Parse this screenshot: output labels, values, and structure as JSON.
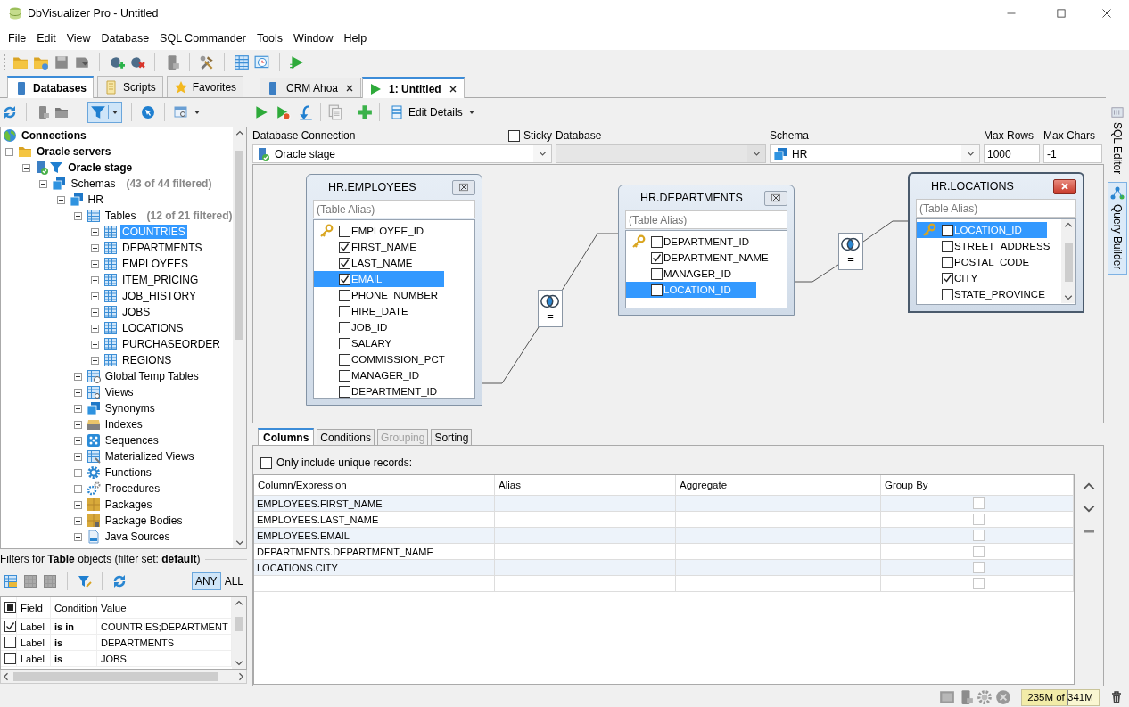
{
  "window": {
    "title": "DbVisualizer Pro - Untitled"
  },
  "menu": [
    "File",
    "Edit",
    "View",
    "Database",
    "SQL Commander",
    "Tools",
    "Window",
    "Help"
  ],
  "left_tabs": [
    {
      "label": "Databases",
      "kind": "databases",
      "selected": true
    },
    {
      "label": "Scripts",
      "kind": "scripts",
      "selected": false
    },
    {
      "label": "Favorites",
      "kind": "favorites",
      "selected": false
    }
  ],
  "tree": {
    "label": "Connections",
    "kind": "root",
    "selected": false,
    "children": [
      {
        "label": "Oracle servers",
        "kind": "folder",
        "expanded": true,
        "selected": false,
        "children": [
          {
            "label": "Oracle stage",
            "kind": "connection",
            "expanded": true,
            "selected": false,
            "children": [
              {
                "label": "Schemas",
                "note": "(43 of 44 filtered)",
                "kind": "schemas",
                "expanded": true,
                "selected": false,
                "children": [
                  {
                    "label": "HR",
                    "kind": "schema",
                    "expanded": true,
                    "selected": false,
                    "children": [
                      {
                        "label": "Tables",
                        "note": "(12 of 21 filtered)",
                        "kind": "tables",
                        "expanded": true,
                        "selected": false,
                        "children": [
                          {
                            "label": "COUNTRIES",
                            "kind": "table",
                            "expanded": false,
                            "selected": true
                          },
                          {
                            "label": "DEPARTMENTS",
                            "kind": "table",
                            "expanded": false,
                            "selected": false
                          },
                          {
                            "label": "EMPLOYEES",
                            "kind": "table",
                            "expanded": false,
                            "selected": false
                          },
                          {
                            "label": "ITEM_PRICING",
                            "kind": "table",
                            "expanded": false,
                            "selected": false
                          },
                          {
                            "label": "JOB_HISTORY",
                            "kind": "table",
                            "expanded": false,
                            "selected": false
                          },
                          {
                            "label": "JOBS",
                            "kind": "table",
                            "expanded": false,
                            "selected": false
                          },
                          {
                            "label": "LOCATIONS",
                            "kind": "table",
                            "expanded": false,
                            "selected": false
                          },
                          {
                            "label": "PURCHASEORDER",
                            "kind": "table",
                            "expanded": false,
                            "selected": false
                          },
                          {
                            "label": "REGIONS",
                            "kind": "table",
                            "expanded": false,
                            "selected": false
                          }
                        ]
                      },
                      {
                        "label": "Global Temp Tables",
                        "kind": "temp-tables",
                        "expanded": false,
                        "selected": false
                      },
                      {
                        "label": "Views",
                        "kind": "views",
                        "expanded": false,
                        "selected": false
                      },
                      {
                        "label": "Synonyms",
                        "kind": "synonyms",
                        "expanded": false,
                        "selected": false
                      },
                      {
                        "label": "Indexes",
                        "kind": "indexes",
                        "expanded": false,
                        "selected": false
                      },
                      {
                        "label": "Sequences",
                        "kind": "sequences",
                        "expanded": false,
                        "selected": false
                      },
                      {
                        "label": "Materialized Views",
                        "kind": "mviews",
                        "expanded": false,
                        "selected": false
                      },
                      {
                        "label": "Functions",
                        "kind": "functions",
                        "expanded": false,
                        "selected": false
                      },
                      {
                        "label": "Procedures",
                        "kind": "procedures",
                        "expanded": false,
                        "selected": false
                      },
                      {
                        "label": "Packages",
                        "kind": "packages",
                        "expanded": false,
                        "selected": false
                      },
                      {
                        "label": "Package Bodies",
                        "kind": "package-bodies",
                        "expanded": false,
                        "selected": false
                      },
                      {
                        "label": "Java Sources",
                        "kind": "java",
                        "expanded": false,
                        "selected": false
                      }
                    ]
                  }
                ]
              }
            ]
          }
        ]
      }
    ]
  },
  "filters": {
    "title": "Filters for **Table** objects (filter set: **default**)",
    "match": [
      {
        "label": "ANY",
        "selected": true
      },
      {
        "label": "ALL",
        "selected": false
      }
    ],
    "select_all_partial": true,
    "columns": [
      "Field",
      "Condition",
      "Value"
    ],
    "rows": [
      {
        "checked": true,
        "field": "Label",
        "condition": "is in",
        "value": "COUNTRIES;DEPARTMENT"
      },
      {
        "checked": false,
        "field": "Label",
        "condition": "is",
        "value": "DEPARTMENTS"
      },
      {
        "checked": false,
        "field": "Label",
        "condition": "is",
        "value": "JOBS"
      }
    ]
  },
  "editor": {
    "tabs": [
      {
        "label": "CRM Ahoa",
        "kind": "connection",
        "selected": false
      },
      {
        "label": "1: Untitled",
        "kind": "query",
        "selected": true
      }
    ],
    "edit_details": "Edit Details",
    "connection": {
      "label": "Database Connection",
      "value": "Oracle stage"
    },
    "sticky": {
      "label": "Sticky",
      "checked": false
    },
    "database": {
      "label": "Database",
      "disabled": true
    },
    "schema": {
      "label": "Schema",
      "value": "HR"
    },
    "max_rows": {
      "label": "Max Rows",
      "value": "1000"
    },
    "max_chars": {
      "label": "Max Chars",
      "value": "-1"
    },
    "tables": [
      {
        "title": "HR.EMPLOYEES",
        "alias_placeholder": "(Table Alias)",
        "focused": false,
        "columns": [
          {
            "name": "EMPLOYEE_ID",
            "key": true,
            "checked": false,
            "selected": false
          },
          {
            "name": "FIRST_NAME",
            "key": false,
            "checked": true,
            "selected": false
          },
          {
            "name": "LAST_NAME",
            "key": false,
            "checked": true,
            "selected": false
          },
          {
            "name": "EMAIL",
            "key": false,
            "checked": true,
            "selected": true
          },
          {
            "name": "PHONE_NUMBER",
            "key": false,
            "checked": false,
            "selected": false
          },
          {
            "name": "HIRE_DATE",
            "key": false,
            "checked": false,
            "selected": false
          },
          {
            "name": "JOB_ID",
            "key": false,
            "checked": false,
            "selected": false
          },
          {
            "name": "SALARY",
            "key": false,
            "checked": false,
            "selected": false
          },
          {
            "name": "COMMISSION_PCT",
            "key": false,
            "checked": false,
            "selected": false
          },
          {
            "name": "MANAGER_ID",
            "key": false,
            "checked": false,
            "selected": false
          },
          {
            "name": "DEPARTMENT_ID",
            "key": false,
            "checked": false,
            "selected": false
          }
        ]
      },
      {
        "title": "HR.DEPARTMENTS",
        "alias_placeholder": "(Table Alias)",
        "focused": false,
        "columns": [
          {
            "name": "DEPARTMENT_ID",
            "key": true,
            "checked": false,
            "selected": false
          },
          {
            "name": "DEPARTMENT_NAME",
            "key": false,
            "checked": true,
            "selected": false
          },
          {
            "name": "MANAGER_ID",
            "key": false,
            "checked": false,
            "selected": false
          },
          {
            "name": "LOCATION_ID",
            "key": false,
            "checked": false,
            "selected": true
          }
        ]
      },
      {
        "title": "HR.LOCATIONS",
        "alias_placeholder": "(Table Alias)",
        "focused": true,
        "columns": [
          {
            "name": "LOCATION_ID",
            "key": true,
            "checked": false,
            "selected": true
          },
          {
            "name": "STREET_ADDRESS",
            "key": false,
            "checked": false,
            "selected": false
          },
          {
            "name": "POSTAL_CODE",
            "key": false,
            "checked": false,
            "selected": false
          },
          {
            "name": "CITY",
            "key": false,
            "checked": true,
            "selected": false
          },
          {
            "name": "STATE_PROVINCE",
            "key": false,
            "checked": false,
            "selected": false
          }
        ]
      }
    ],
    "joins": [
      {
        "operator": "="
      },
      {
        "operator": "="
      }
    ]
  },
  "side_tabs": [
    {
      "label": "SQL Editor",
      "selected": false
    },
    {
      "label": "Query Builder",
      "selected": true
    }
  ],
  "builder": {
    "tabs": [
      {
        "label": "Columns",
        "selected": true,
        "disabled": false
      },
      {
        "label": "Conditions",
        "selected": false,
        "disabled": false
      },
      {
        "label": "Grouping",
        "selected": false,
        "disabled": true
      },
      {
        "label": "Sorting",
        "selected": false,
        "disabled": false
      }
    ],
    "unique": {
      "label": "Only include unique records:",
      "checked": false
    },
    "columns": [
      "Column/Expression",
      "Alias",
      "Aggregate",
      "Group By"
    ],
    "rows": [
      {
        "expression": "EMPLOYEES.FIRST_NAME",
        "group_by": false
      },
      {
        "expression": "EMPLOYEES.LAST_NAME",
        "group_by": false
      },
      {
        "expression": "EMPLOYEES.EMAIL",
        "group_by": false
      },
      {
        "expression": "DEPARTMENTS.DEPARTMENT_NAME",
        "group_by": false
      },
      {
        "expression": "LOCATIONS.CITY",
        "group_by": false
      },
      {
        "group_by": false
      }
    ]
  },
  "status_bar": {
    "memory": "235M of 341M",
    "level": 0.6
  }
}
